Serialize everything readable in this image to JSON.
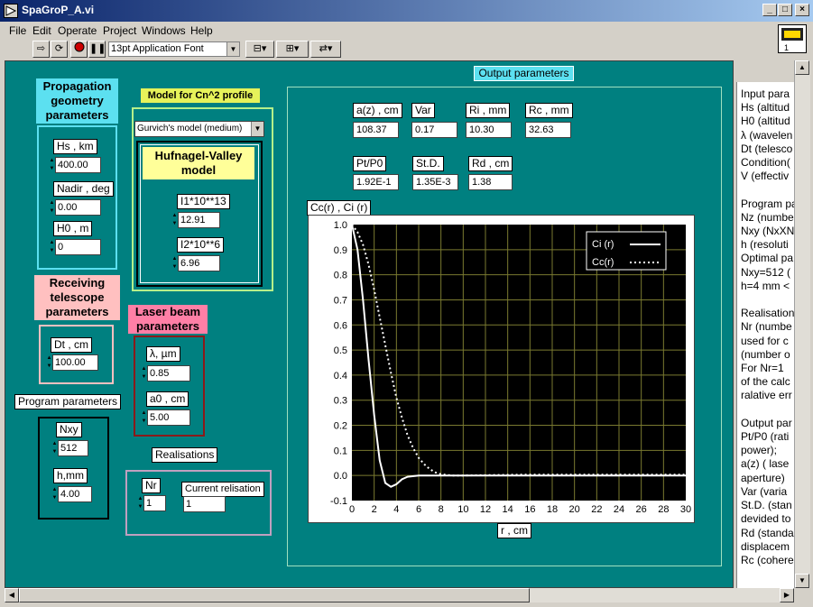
{
  "window": {
    "title": "SpaGroP_A.vi"
  },
  "menu": [
    "File",
    "Edit",
    "Operate",
    "Project",
    "Windows",
    "Help"
  ],
  "toolbar": {
    "font": "13pt Application Font",
    "probe_label": "1"
  },
  "propagation": {
    "title_line1": "Propagation",
    "title_line2": "geometry",
    "title_line3": "parameters",
    "hs_label": "Hs , km",
    "hs_value": "400.00",
    "nadir_label": "Nadir , deg",
    "nadir_value": "0.00",
    "h0_label": "H0 , m",
    "h0_value": "0"
  },
  "cn2": {
    "title": "Model for Cn^2 profile",
    "model_select": "Gurvich's model (medium)",
    "hv_line1": "Hufnagel-Valley",
    "hv_line2": "model",
    "i1_label": "I1*10**13",
    "i1_value": "12.91",
    "i2_label": "I2*10**6",
    "i2_value": "6.96"
  },
  "telescope": {
    "title_line1": "Receiving",
    "title_line2": "telescope",
    "title_line3": "parameters",
    "dt_label": "Dt , cm",
    "dt_value": "100.00"
  },
  "laser": {
    "title_line1": "Laser beam",
    "title_line2": "parameters",
    "lambda_label": "λ, µm",
    "lambda_value": "0.85",
    "a0_label": "a0 , cm",
    "a0_value": "5.00"
  },
  "program": {
    "title": "Program parameters",
    "nxy_label": "Nxy",
    "nxy_value": "512",
    "h_label": "h,mm",
    "h_value": "4.00"
  },
  "realisations": {
    "title": "Realisations",
    "nr_label": "Nr",
    "nr_value": "1",
    "current_label": "Current relisation",
    "current_value": "1"
  },
  "output": {
    "title": "Output parameters",
    "az_label": "a(z) , cm",
    "az_value": "108.37",
    "var_label": "Var",
    "var_value": "0.17",
    "ri_label": "Ri , mm",
    "ri_value": "10.30",
    "rc_label": "Rc , mm",
    "rc_value": "32.63",
    "ptp0_label": "Pt/P0",
    "ptp0_value": "1.92E-1",
    "std_label": "St.D.",
    "std_value": "1.35E-3",
    "rd_label": "Rd , cm",
    "rd_value": "1.38"
  },
  "chart_data": {
    "type": "line",
    "title": "Cc(r) , Ci (r)",
    "xlabel": "r , cm",
    "ylabel": "",
    "xlim": [
      0,
      30
    ],
    "ylim": [
      -0.1,
      1.0
    ],
    "x_ticks": [
      "0",
      "2",
      "4",
      "6",
      "8",
      "10",
      "12",
      "14",
      "16",
      "18",
      "20",
      "22",
      "24",
      "26",
      "28",
      "30"
    ],
    "y_ticks": [
      "1.0",
      "0.9",
      "0.8",
      "0.7",
      "0.6",
      "0.5",
      "0.4",
      "0.3",
      "0.2",
      "0.1",
      "0.0",
      "-0.1"
    ],
    "grid": true,
    "legend_position": "top-right",
    "series": [
      {
        "name": "Ci (r)",
        "style": "solid",
        "color": "#ffffff",
        "x": [
          0,
          0.5,
          1.0,
          1.5,
          2.0,
          2.5,
          3.0,
          3.5,
          4.0,
          4.5,
          5.0,
          6.0,
          7.0,
          8.0,
          10.0,
          15.0,
          20.0,
          25.0,
          30.0
        ],
        "y": [
          1.0,
          0.9,
          0.7,
          0.46,
          0.24,
          0.06,
          -0.03,
          -0.045,
          -0.035,
          -0.015,
          -0.005,
          0.0,
          0.0,
          0.0,
          0.0,
          0.0,
          0.0,
          0.0,
          0.0
        ]
      },
      {
        "name": "Cc(r)",
        "style": "dotted",
        "color": "#ffffff",
        "x": [
          0,
          0.5,
          1.0,
          1.5,
          2.0,
          2.5,
          3.0,
          3.5,
          4.0,
          4.5,
          5.0,
          5.5,
          6.0,
          6.5,
          7.0,
          7.5,
          8.0,
          9.0,
          10.0,
          15.0,
          20.0,
          25.0,
          30.0
        ],
        "y": [
          1.0,
          0.97,
          0.92,
          0.84,
          0.74,
          0.63,
          0.52,
          0.41,
          0.31,
          0.23,
          0.16,
          0.11,
          0.07,
          0.045,
          0.025,
          0.012,
          0.005,
          0.0,
          0.0,
          0.003,
          0.003,
          0.003,
          0.003
        ]
      }
    ]
  },
  "info_text": [
    "Input para",
    "Hs (altitud",
    "H0 (altitud",
    "λ (wavelen",
    "Dt (telesco",
    "Condition(",
    "V (effectiv",
    "",
    "Program pa",
    "Nz (numbe",
    "Nxy (NxXN",
    "h (resoluti",
    "Optimal pa",
    "Nxy=512 (",
    "h=4 mm <",
    "",
    "Realisation",
    "Nr (numbe",
    "used for c",
    "(number o",
    "For Nr=1",
    "of the calc",
    "ralative err",
    "",
    "Output par",
    "Pt/P0 (rati",
    "power);",
    "a(z) ( lase",
    "aperture)",
    "Var (varia",
    "St.D. (stan",
    "devided to",
    "Rd (standa",
    "displacem",
    "Rc (cohere"
  ]
}
